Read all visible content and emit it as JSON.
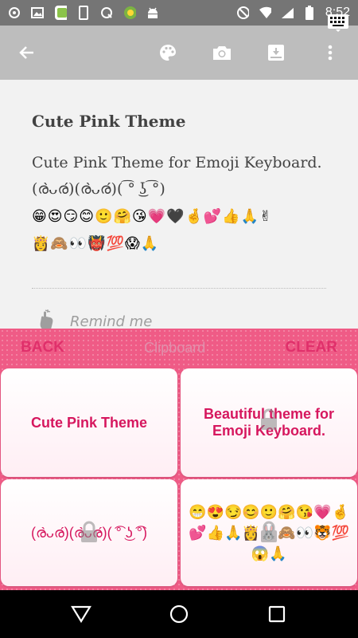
{
  "statusbar": {
    "time": "8:52",
    "left_icons": [
      "circle-c-icon",
      "image-icon",
      "app-icon",
      "phone-icon",
      "q-icon",
      "ball-icon",
      "android-icon"
    ],
    "right_icons": [
      "dnd-icon",
      "wifi-icon",
      "signal-icon",
      "battery-icon"
    ]
  },
  "toolbar": {
    "back_icon": "arrow-back-icon",
    "actions": [
      "palette-icon",
      "camera-icon",
      "archive-icon",
      "more-vert-icon"
    ]
  },
  "note": {
    "title": "Cute Pink Theme",
    "body": "Cute Pink Theme for Emoji Keyboard.(ര̀ᴗര́)(ര̀ᴗര́)( ͡° ͜ʖ ͡°)",
    "emoji_line1": "😁😍😏😊🙂🤗😘💗🖤🤞💕👍🙏✌",
    "emoji_line2": "👸🙈👀👹💯😱🙏"
  },
  "remind": {
    "label": "Remind me"
  },
  "keyboard": {
    "back_label": "BACK",
    "title": "Clipboard",
    "clear_label": "CLEAR",
    "clips": [
      {
        "text": "Cute Pink Theme"
      },
      {
        "text": "Beautiful theme for Emoji Keyboard."
      },
      {
        "text": "(ര̀ᴗര́)(ര̀ᴗര́)( ͡° ͜ʖ ͡°)"
      },
      {
        "text": "😁😍😏😊🙂🤗😘💗🤞💕👍🙏👸🐰🙈👀🐯💯😱🙏"
      }
    ],
    "accent_color": "#ef5b86",
    "text_color": "#d6175e"
  },
  "navbar": {
    "buttons": [
      "back-triangle-icon",
      "home-circle-icon",
      "recents-square-icon",
      "keyboard-icon"
    ]
  }
}
